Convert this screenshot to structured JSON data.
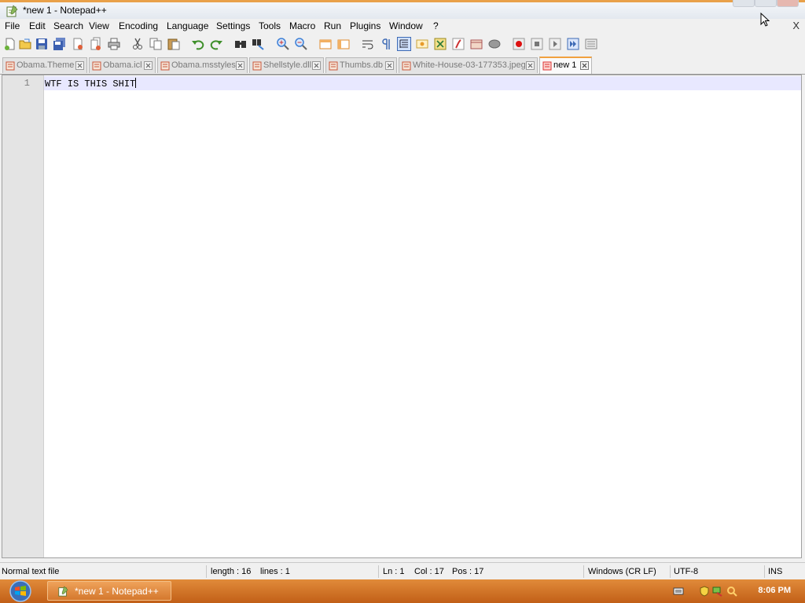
{
  "window": {
    "title": "*new 1 - Notepad++"
  },
  "menu": [
    "File",
    "Edit",
    "Search",
    "View",
    "Encoding",
    "Language",
    "Settings",
    "Tools",
    "Macro",
    "Run",
    "Plugins",
    "Window",
    "?"
  ],
  "menu_close_label": "X",
  "tabs": [
    {
      "label": "Obama.Theme",
      "active": false
    },
    {
      "label": "Obama.icl",
      "active": false
    },
    {
      "label": "Obama.msstyles",
      "active": false
    },
    {
      "label": "Shellstyle.dll",
      "active": false
    },
    {
      "label": "Thumbs.db",
      "active": false
    },
    {
      "label": "White-House-03-177353.jpeg",
      "active": false
    },
    {
      "label": "new 1",
      "active": true
    }
  ],
  "editor": {
    "line_number": "1",
    "text": "WTF IS THIS SHIT"
  },
  "statusbar": {
    "file_type": "Normal text file",
    "length": "length : 16",
    "lines": "lines : 1",
    "ln": "Ln : 1",
    "col": "Col : 17",
    "pos": "Pos : 17",
    "eol": "Windows (CR LF)",
    "encoding": "UTF-8",
    "mode": "INS"
  },
  "taskbar": {
    "item_label": "*new 1 - Notepad++",
    "clock": "8:06 PM"
  },
  "colors": {
    "title_accent": "#e9a14a",
    "taskbar": "#d06e24",
    "current_line": "#e8e8ff",
    "active_tab_accent": "#f1a13f"
  },
  "icons": {
    "toolbar": [
      "new-file-icon",
      "open-file-icon",
      "save-icon",
      "save-all-icon",
      "close-icon",
      "close-all-icon",
      "print-icon",
      "cut-icon",
      "copy-icon",
      "paste-icon",
      "undo-icon",
      "redo-icon",
      "find-icon",
      "replace-icon",
      "zoom-in-icon",
      "zoom-out-icon",
      "sync-vertical-icon",
      "sync-horizontal-icon",
      "word-wrap-icon",
      "show-all-chars-icon",
      "indent-guide-icon",
      "user-lang-icon",
      "doc-map-icon",
      "function-list-icon",
      "folder-workspace-icon",
      "monitoring-icon",
      "record-macro-icon",
      "stop-record-icon",
      "play-macro-icon",
      "run-macro-multiple-icon",
      "save-macro-icon"
    ]
  }
}
